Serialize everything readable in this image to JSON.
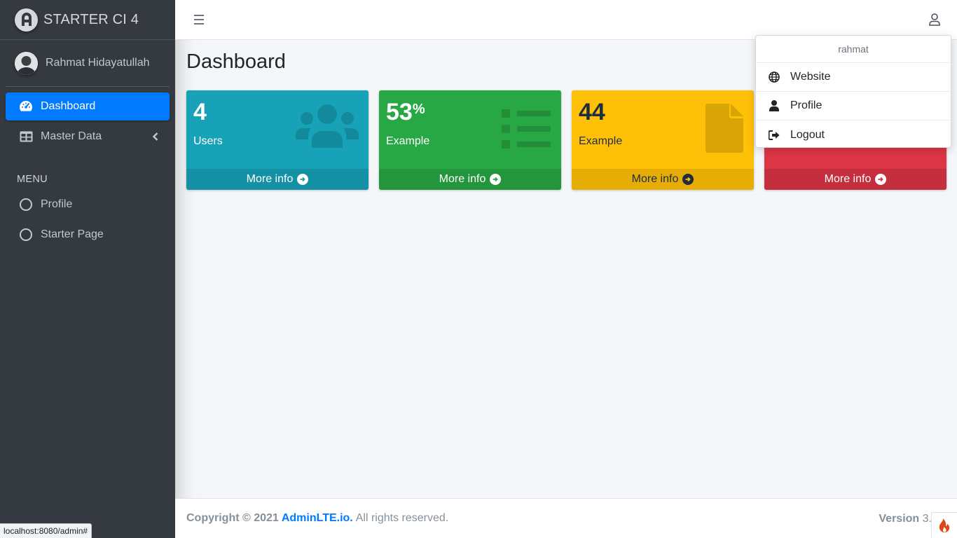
{
  "brand": {
    "name": "STARTER CI 4"
  },
  "user_panel": {
    "name": "Rahmat Hidayatullah"
  },
  "sidebar": {
    "items": [
      {
        "label": "Dashboard",
        "icon": "tachometer-icon",
        "active": true
      },
      {
        "label": "Master Data",
        "icon": "table-icon",
        "active": false
      }
    ],
    "header": "MENU",
    "menu_items": [
      {
        "label": "Profile",
        "icon": "circle-icon"
      },
      {
        "label": "Starter Page",
        "icon": "circle-icon"
      }
    ]
  },
  "page": {
    "title": "Dashboard"
  },
  "boxes": [
    {
      "value": "4",
      "suffix": "",
      "label": "Users",
      "footer": "More info",
      "color": "#17a2b8",
      "icon": "users-icon"
    },
    {
      "value": "53",
      "suffix": "%",
      "label": "Example",
      "footer": "More info",
      "color": "#28a745",
      "icon": "list-icon"
    },
    {
      "value": "44",
      "suffix": "",
      "label": "Example",
      "footer": "More info",
      "color": "#ffc107",
      "icon": "file-icon"
    },
    {
      "value": "",
      "suffix": "",
      "label": "",
      "footer": "More info",
      "color": "#dc3545",
      "icon": ""
    }
  ],
  "dropdown": {
    "header": "rahmat",
    "items": [
      {
        "label": "Website",
        "icon": "globe-icon"
      },
      {
        "label": "Profile",
        "icon": "user-icon"
      },
      {
        "label": "Logout",
        "icon": "sign-out-icon"
      }
    ]
  },
  "footer": {
    "copyright": "Copyright © 2021",
    "link": "AdminLTE.io.",
    "rights": "All rights reserved.",
    "version_label": "Version",
    "version_value": "3."
  },
  "status_bar": {
    "url": "localhost:8080/admin#"
  },
  "colors": {
    "sidebar": "#343a40",
    "accent": "#007bff"
  }
}
